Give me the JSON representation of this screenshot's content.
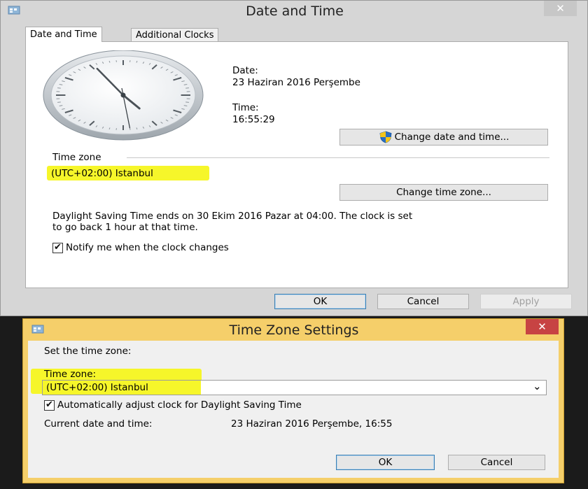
{
  "date_time_window": {
    "title": "Date and Time",
    "close_label": "✕",
    "tabs": [
      {
        "label": "Date and Time",
        "active": true
      },
      {
        "label": "Additional Clocks",
        "active": false
      }
    ],
    "date_label": "Date:",
    "date_value": "23 Haziran 2016 Perşembe",
    "time_label": "Time:",
    "time_value": "16:55:29",
    "change_date_time_label": "Change date and time...",
    "timezone_section_label": "Time zone",
    "timezone_value": "(UTC+02:00) Istanbul",
    "change_timezone_label": "Change time zone...",
    "dst_text_line1": "Daylight Saving Time ends on 30 Ekim 2016 Pazar at 04:00. The clock is set",
    "dst_text_line2": "to go back 1 hour at that time.",
    "notify_label": "Notify me when the clock changes",
    "notify_checked": true,
    "ok_label": "OK",
    "cancel_label": "Cancel",
    "apply_label": "Apply"
  },
  "timezone_window": {
    "title": "Time Zone Settings",
    "close_label": "✕",
    "set_label": "Set the time zone:",
    "timezone_label": "Time zone:",
    "selected_timezone": "(UTC+02:00) Istanbul",
    "auto_adjust_label": "Automatically adjust clock for Daylight Saving Time",
    "auto_adjust_checked": true,
    "current_label": "Current date and time:",
    "current_value": "23 Haziran 2016 Perşembe, 16:55",
    "ok_label": "OK",
    "cancel_label": "Cancel"
  },
  "clock": {
    "hour": 16,
    "minute": 55,
    "second": 29
  },
  "colors": {
    "highlight": "#f6f62a",
    "timezone_frame": "#f5cf6a"
  },
  "glyphs": {
    "check": "✔",
    "chevron_down": "⌄"
  }
}
